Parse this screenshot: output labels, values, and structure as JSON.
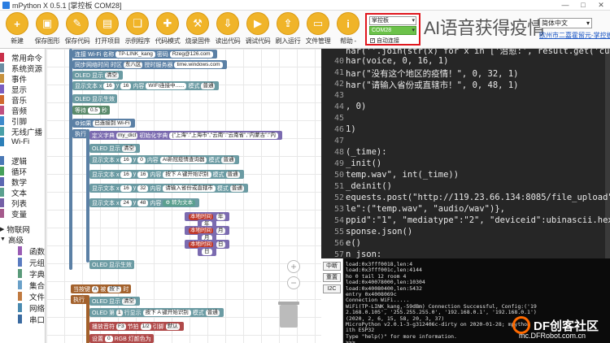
{
  "window": {
    "title": "mPython X 0.5.1 [掌控板 COM28]",
    "minimize": "—",
    "maximize": "□",
    "close": "✕"
  },
  "toolbar": [
    {
      "label": "新建",
      "icon": "new-file-icon",
      "glyph": "+"
    },
    {
      "label": "保存图形",
      "icon": "save-graphic-icon",
      "glyph": "▣"
    },
    {
      "label": "保存代码",
      "icon": "save-code-icon",
      "glyph": "✎"
    },
    {
      "label": "打开项目",
      "icon": "open-project-icon",
      "glyph": "▤"
    },
    {
      "label": "示例程序",
      "icon": "examples-icon",
      "glyph": "❏"
    },
    {
      "label": "代码模式",
      "icon": "code-mode-icon",
      "glyph": "✚"
    },
    {
      "label": "烧录固件",
      "icon": "flash-firmware-icon",
      "glyph": "⚒"
    },
    {
      "label": "读出代码",
      "icon": "read-code-icon",
      "glyph": "⇩"
    },
    {
      "label": "调试代码",
      "icon": "debug-code-icon",
      "glyph": "▶"
    },
    {
      "label": "刷入运行",
      "icon": "upload-run-icon",
      "glyph": "⇪"
    },
    {
      "label": "文件管理",
      "icon": "file-manager-icon",
      "glyph": "▭"
    },
    {
      "label": "帮助 -",
      "icon": "help-icon",
      "glyph": "i"
    }
  ],
  "board": {
    "board_select": "掌控板",
    "port_select": "COM28",
    "auto_connect_label": "自动连接",
    "auto_connect_checked": true
  },
  "banner_title": "AI语音获得疫情",
  "language": {
    "select": "简体中文",
    "link": "欧州市二嘉霍留元-掌控板"
  },
  "categories": [
    {
      "label": "常用命令",
      "color": "#c9304a"
    },
    {
      "label": "系统资源",
      "color": "#6b8ea3"
    },
    {
      "label": "事件",
      "color": "#c7923e"
    },
    {
      "label": "显示",
      "color": "#7a5ec1"
    },
    {
      "label": "音乐",
      "color": "#d06a2f"
    },
    {
      "label": "音频",
      "color": "#c05080"
    },
    {
      "label": "引脚",
      "color": "#3e8acb"
    },
    {
      "label": "无线广播",
      "color": "#4aa0a8"
    },
    {
      "label": "Wi-Fi",
      "color": "#2c7fb8"
    },
    {
      "label": "逻辑",
      "color": "#4a78b5"
    },
    {
      "label": "循环",
      "color": "#46a05a"
    },
    {
      "label": "数学",
      "color": "#5b67b1"
    },
    {
      "label": "文本",
      "color": "#5ba08f"
    },
    {
      "label": "列表",
      "color": "#745fa6"
    },
    {
      "label": "变量",
      "color": "#a55a8c"
    },
    {
      "label": "物联网",
      "color": "",
      "arrow": "▶"
    },
    {
      "label": "高级",
      "color": "",
      "arrow": "▼"
    },
    {
      "label": "函数",
      "color": "#9a5cb4",
      "sub": true
    },
    {
      "label": "元组",
      "color": "#5a7bc0",
      "sub": true
    },
    {
      "label": "字典",
      "color": "#5a9a7a",
      "sub": true
    },
    {
      "label": "集合",
      "color": "#6aa0c8",
      "sub": true
    },
    {
      "label": "文件",
      "color": "#c07a40",
      "sub": true
    },
    {
      "label": "网络",
      "color": "#4a8ab0",
      "sub": true
    },
    {
      "label": "串口",
      "color": "#3a6aa0",
      "sub": true
    }
  ],
  "blocks": {
    "wifi": {
      "prefix": "连接 Wi-Fi 名称",
      "ssid": "TP-LINK_kang",
      "pwd_label": "密码",
      "pwd": "Rzeg@126.com"
    },
    "ntp": {
      "prefix": "同步网络时间 时区",
      "tz": "东八区",
      "server_label": "授时服务器",
      "server": "time.windows.com"
    },
    "oled1": {
      "label": "OLED 显示",
      "mode": "清空"
    },
    "text1": {
      "label": "显示文本 x",
      "x": "16",
      "y": "16",
      "content_label": "内容",
      "content": "WIFI连接中......",
      "mode_label": "模式",
      "mode": "普通"
    },
    "oled_show": "OLED 显示生效",
    "wait": {
      "label": "等待",
      "value": "0.5",
      "unit": "秒"
    },
    "if_block": {
      "if_label": "如果",
      "cond": "已连接到 Wi-Fi",
      "do_label": "执行"
    },
    "dict": {
      "label": "定义字典",
      "name": "my_dict",
      "value_label": "初始化字典",
      "value": "{\"上海\":\"上海市\",\"云南\":\"云南省\",\"内蒙古\":\"内"
    },
    "oled2": {
      "label": "OLED 显示",
      "mode": "清空"
    },
    "text2": {
      "label": "显示文本 x",
      "x": "16",
      "y": "0",
      "content": "AI新冠疫情查询器",
      "mode": "普通"
    },
    "text3": {
      "label": "显示文本 x",
      "x": "16",
      "y": "16",
      "content": "按下 A 键开始识别",
      "mode": "普通"
    },
    "text4": {
      "label": "显示文本 x",
      "x": "16",
      "y": "32",
      "content": "请输入省份或直辖市",
      "mode": "普通"
    },
    "text5": {
      "label": "显示文本 x",
      "x": "24",
      "y": "48",
      "content_label": "内容",
      "convert": "转为文本"
    },
    "time_parts": [
      {
        "fn": "本地时间",
        "unit": "年",
        "sep": "年"
      },
      {
        "fn": "本地时间",
        "unit": "月",
        "sep": "月"
      },
      {
        "fn": "本地时间",
        "unit": "日",
        "sep": "日"
      }
    ],
    "oled_show2": "OLED 显示生效",
    "event": {
      "label": "当按键",
      "key": "A",
      "state_label": "被",
      "state": "按下",
      "tail": "时"
    },
    "oled3": {
      "label": "OLED 显示",
      "mode": "清空"
    },
    "oled_line": {
      "label": "OLED 第",
      "row": "1",
      "mid": "行显示",
      "content": "按下 A 键开始识别",
      "mode": "普通"
    },
    "note": {
      "label": "播放音符",
      "note": "F3",
      "beat_label": "节拍",
      "beat": "1/2",
      "pin_label": "引脚",
      "pin": "默认"
    },
    "rgb": {
      "label": "设置",
      "index": "0",
      "tail": "RGB 灯颜色为"
    }
  },
  "editor": {
    "lines": [
      {
        "n": "",
        "code": "har(''.join(str(x) for x in ['治愈:', result.get('cu"
      },
      {
        "n": "40",
        "code": "har(voice, 0, 16, 1)"
      },
      {
        "n": "41",
        "code": "har(\"没有这个地区的疫情！\", 0, 32, 1)"
      },
      {
        "n": "42",
        "code": "har(\"请输入省份或直辖市！\", 0, 48, 1)"
      },
      {
        "n": "43",
        "code": ""
      },
      {
        "n": "44",
        "code": ", 0)"
      },
      {
        "n": "45",
        "code": ""
      },
      {
        "n": "46",
        "code": "1)"
      },
      {
        "n": "47",
        "code": ""
      },
      {
        "n": "48",
        "code": "(_time):"
      },
      {
        "n": "49",
        "code": "_init()"
      },
      {
        "n": "50",
        "code": "temp.wav\", int(_time))"
      },
      {
        "n": "51",
        "code": "_deinit()"
      },
      {
        "n": "52",
        "code": "equests.post(\"http://119.23.66.134:8085/file_upload\","
      },
      {
        "n": "53",
        "code": "le\":(\"temp.wav\", \"audio/wav\")},"
      },
      {
        "n": "54",
        "code": "ppid\":\"1\", \"mediatype\":\"2\", \"deviceid\":ubinascii.hexli"
      },
      {
        "n": "55",
        "code": "sponse.json()"
      },
      {
        "n": "56",
        "code": "e()"
      },
      {
        "n": "57",
        "code": "n_json:"
      }
    ]
  },
  "serial": {
    "buttons": [
      "中断",
      "重置",
      "I2C"
    ],
    "output": [
      "load:0x3fff0018,len:4",
      "load:0x3fff001c,len:4144",
      "ho 0 tail 12 room 4",
      "load:0x40078000,len:10304",
      "load:0x40080400,len:5432",
      "entry 0x4008069c",
      "Connection WiFi.....",
      "WiFi(TP-LINK_kang,-59dBm) Connection Successful, Config:('19",
      "2.168.0.105', '255.255.255.0', '192.168.0.1', '192.168.0.1')",
      "(2020, 2, 6, 15, 58, 20, 3, 37)",
      "MicroPython v2.0.1-3-g312406c-dirty on 2020-01-28; mpython",
      "ith ESP32",
      "Type \"help()\" for more information.",
      ">>>"
    ]
  },
  "watermark": {
    "brand": "DF创客社区",
    "url": "mc.DFRobot.com.cn"
  }
}
